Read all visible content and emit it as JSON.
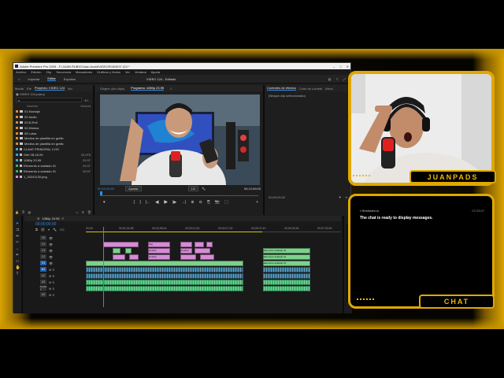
{
  "window": {
    "title": "Adobe Premiere Pro 2025 - F:\\JUAN RUBIO\\Juan Avoid\\VIDEOS\\VIDEO 124 *",
    "controls": [
      "–",
      "□",
      "✕"
    ]
  },
  "menu": [
    "Archivo",
    "Edición",
    "Clip",
    "Secuencia",
    "Marcadores",
    "Gráficos y títulos",
    "Ver",
    "Ventana",
    "Ayuda"
  ],
  "workspaces": {
    "home_icon": "home-icon",
    "items": [
      "Importar",
      "Editar",
      "Exportar"
    ],
    "active": "Editar",
    "center": "VIDEO 124 - Editado"
  },
  "project_panel": {
    "tabs": [
      "Media",
      "Efe",
      "Proyecto: VIDEO 124",
      "Mo"
    ],
    "active_tab": "Proyecto: VIDEO 124",
    "file": "VIDEO 124.prproj",
    "count": "40...",
    "col_name": "Nombre",
    "col_rate": "Velocid",
    "bins": [
      {
        "name": "01 Montaje",
        "color": "#e08a2c",
        "type": "folder",
        "rate": ""
      },
      {
        "name": "02 Audio",
        "color": "#e08a2c",
        "type": "folder",
        "rate": ""
      },
      {
        "name": "03 B-Roll",
        "color": "#e08a2c",
        "type": "folder",
        "rate": ""
      },
      {
        "name": "04 Música",
        "color": "#e08a2c",
        "type": "folder",
        "rate": ""
      },
      {
        "name": "05 Lutas",
        "color": "#e08a2c",
        "type": "folder",
        "rate": ""
      },
      {
        "name": "Medios de plantilla en gráfic",
        "color": "#e08a2c",
        "type": "folder",
        "rate": ""
      },
      {
        "name": "Medios de plantilla en gráfic",
        "color": "#e08a2c",
        "type": "folder",
        "rate": ""
      },
      {
        "name": "CLAVE PRINCIPAL 2.OS",
        "color": "#3aa3d8",
        "type": "file",
        "rate": ""
      },
      {
        "name": "Glef 1B.16.09",
        "color": "#3aa3d8",
        "type": "file",
        "rate": "23,976"
      },
      {
        "name": "1080p 23.95",
        "color": "#3aa3d8",
        "type": "file",
        "rate": "29,97"
      },
      {
        "name": "Elemento a anidado 01",
        "color": "#3bb36b",
        "type": "file",
        "rate": "29,97"
      },
      {
        "name": "Elemento a anidado 01",
        "color": "#3bb36b",
        "type": "file",
        "rate": "29,97"
      },
      {
        "name": "1_20241130.png",
        "color": "#d58cd6",
        "type": "file",
        "rate": ""
      }
    ]
  },
  "monitor": {
    "tabs": [
      "Origen: (sin clips)",
      "Programa: 1080p 23.95",
      "≡"
    ],
    "active_tab": "Programa: 1080p 23.95",
    "timecode": "00;00;00;00",
    "fit": "Ajustar",
    "quality": "1/2",
    "duration": "00;12;09;00",
    "controls": [
      "{",
      "}",
      "|←",
      "◀|",
      "▶",
      "|▶",
      "→|",
      "⊕",
      "⊖",
      "⎘",
      "📷",
      "⬚",
      "+"
    ]
  },
  "effects_panel": {
    "tabs": [
      "Controles de efectos",
      "Color de Lumetri",
      "Mezc"
    ],
    "active_tab": "Controles de efectos",
    "message": "(Ningún clip seleccionado)",
    "footer_time": "00;00;00;00"
  },
  "timeline": {
    "sequence_tab": "1080p 23.95",
    "timecode": "00;00;00;00",
    "ruler": [
      "00;00",
      "00;01;04;08",
      "00;02;08;16",
      "00;03;12;24",
      "00;04;17;02",
      "00;05;21;10",
      "00;06;25;18",
      "00;07;30;00"
    ],
    "tracks": [
      "V5",
      "V4",
      "V3",
      "V2",
      "V1",
      "A1",
      "A2",
      "A3",
      "Audio 1",
      "A5"
    ],
    "clips": [
      {
        "label": "",
        "kind": "pink",
        "track": 1,
        "start": 22,
        "len": 45
      },
      {
        "label": "Tag",
        "kind": "pink",
        "track": 1,
        "start": 79,
        "len": 28
      },
      {
        "label": "",
        "kind": "pink",
        "track": 1,
        "start": 120,
        "len": 15
      },
      {
        "label": "",
        "kind": "pink",
        "track": 1,
        "start": 138,
        "len": 12
      },
      {
        "label": "",
        "kind": "pink",
        "track": 1,
        "start": 153,
        "len": 8
      },
      {
        "label": "",
        "kind": "green",
        "track": 2,
        "start": 34,
        "len": 10
      },
      {
        "label": "",
        "kind": "green",
        "track": 2,
        "start": 50,
        "len": 8
      },
      {
        "label": "Grafica",
        "kind": "pink",
        "track": 2,
        "start": 79,
        "len": 28
      },
      {
        "label": "Grafica",
        "kind": "pink",
        "track": 2,
        "start": 120,
        "len": 15
      },
      {
        "label": "",
        "kind": "pink",
        "track": 2,
        "start": 138,
        "len": 20
      },
      {
        "label": "Elemento anidado 01",
        "kind": "green",
        "track": 2,
        "start": 225,
        "len": 60
      },
      {
        "label": "",
        "kind": "pink",
        "track": 3,
        "start": 34,
        "len": 16
      },
      {
        "label": "",
        "kind": "pink",
        "track": 3,
        "start": 55,
        "len": 12
      },
      {
        "label": "Grafica",
        "kind": "pink",
        "track": 3,
        "start": 79,
        "len": 28
      },
      {
        "label": "",
        "kind": "pink",
        "track": 3,
        "start": 120,
        "len": 20
      },
      {
        "label": "",
        "kind": "pink",
        "track": 3,
        "start": 145,
        "len": 18
      },
      {
        "label": "Elemento anidado 01",
        "kind": "green",
        "track": 3,
        "start": 225,
        "len": 60
      },
      {
        "label": "",
        "kind": "green",
        "track": 4,
        "start": 0,
        "len": 200
      },
      {
        "label": "Elemento anidado 01",
        "kind": "green",
        "track": 4,
        "start": 225,
        "len": 60
      },
      {
        "label": "",
        "kind": "aud",
        "track": 5,
        "start": 0,
        "len": 200
      },
      {
        "label": "",
        "kind": "aud",
        "track": 5,
        "start": 225,
        "len": 60
      },
      {
        "label": "",
        "kind": "aud",
        "track": 6,
        "start": 0,
        "len": 200
      },
      {
        "label": "",
        "kind": "aud",
        "track": 6,
        "start": 225,
        "len": 60
      },
      {
        "label": "",
        "kind": "aud2",
        "track": 7,
        "start": 0,
        "len": 200
      },
      {
        "label": "",
        "kind": "aud2",
        "track": 7,
        "start": 225,
        "len": 60
      },
      {
        "label": "",
        "kind": "aud2",
        "track": 8,
        "start": 0,
        "len": 200
      },
      {
        "label": "",
        "kind": "aud2",
        "track": 8,
        "start": 225,
        "len": 60
      }
    ]
  },
  "webcam": {
    "name": "JUANPADS"
  },
  "chat": {
    "from": "Restream.io",
    "time": "07:23:07",
    "message": "The chat is ready to display messages.",
    "label": "CHAT"
  },
  "colors": {
    "accent": "#e0a800",
    "premiere_blue": "#2d8ceb"
  }
}
